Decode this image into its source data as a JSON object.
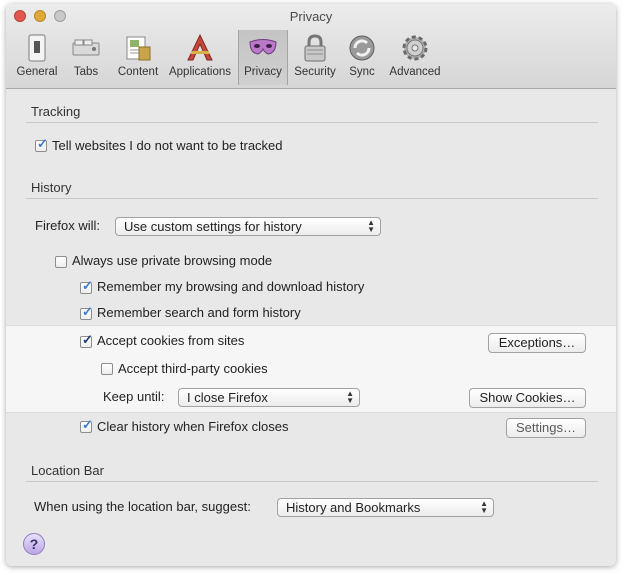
{
  "window": {
    "title": "Privacy"
  },
  "toolbar": {
    "items": [
      {
        "label": "General",
        "icon": "general-switch-icon",
        "selected": false
      },
      {
        "label": "Tabs",
        "icon": "tabs-icon",
        "selected": false
      },
      {
        "label": "Content",
        "icon": "content-icon",
        "selected": false
      },
      {
        "label": "Applications",
        "icon": "applications-icon",
        "selected": false
      },
      {
        "label": "Privacy",
        "icon": "privacy-mask-icon",
        "selected": true
      },
      {
        "label": "Security",
        "icon": "security-lock-icon",
        "selected": false
      },
      {
        "label": "Sync",
        "icon": "sync-icon",
        "selected": false
      },
      {
        "label": "Advanced",
        "icon": "advanced-gear-icon",
        "selected": false
      }
    ]
  },
  "tracking": {
    "heading": "Tracking",
    "do_not_track": {
      "label": "Tell websites I do not want to be tracked",
      "checked": true
    }
  },
  "history": {
    "heading": "History",
    "firefox_will_label": "Firefox will:",
    "firefox_will_value": "Use custom settings for history",
    "private_mode": {
      "label": "Always use private browsing mode",
      "checked": false
    },
    "remember_browsing": {
      "label": "Remember my browsing and download history",
      "checked": true
    },
    "remember_search": {
      "label": "Remember search and form history",
      "checked": true
    },
    "accept_cookies": {
      "label": "Accept cookies from sites",
      "checked": true
    },
    "exceptions_button": "Exceptions…",
    "third_party": {
      "label": "Accept third-party cookies",
      "checked": false
    },
    "keep_until_label": "Keep until:",
    "keep_until_value": "I close Firefox",
    "show_cookies_button": "Show Cookies…",
    "clear_history": {
      "label": "Clear history when Firefox closes",
      "checked": true
    },
    "settings_button": "Settings…"
  },
  "location_bar": {
    "heading": "Location Bar",
    "suggest_label": "When using the location bar, suggest:",
    "suggest_value": "History and Bookmarks"
  },
  "help": {
    "symbol": "?"
  },
  "colors": {
    "checkbox_tick": "#3d7bd1",
    "highlight_background": "#f6f6f6",
    "window_background": "#e8e8e8"
  }
}
